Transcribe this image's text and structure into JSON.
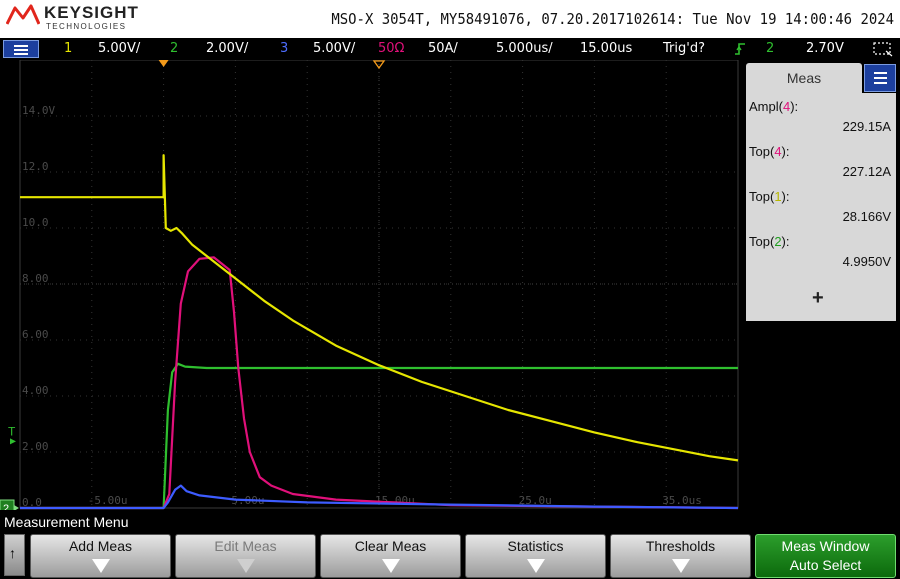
{
  "header": {
    "brand": "KEYSIGHT",
    "brand_sub": "TECHNOLOGIES",
    "scope_info": "MSO-X 3054T, MY58491076, 07.20.2017102614: Tue Nov 19 14:00:46 2024"
  },
  "status_bar": {
    "ch1_num": "1",
    "ch1_scale": "5.00V/",
    "ch2_num": "2",
    "ch2_scale": "2.00V/",
    "ch3_num": "3",
    "ch3_scale": "5.00V/",
    "ch4_label": "50Ω",
    "ch4_scale": "50A/",
    "timebase": "5.000us/",
    "delay": "15.00us",
    "trigger_status": "Trig'd?",
    "trigger_edge_icon": "rising-edge-icon",
    "trigger_source": "2",
    "trigger_level": "2.70V",
    "colors": {
      "ch1": "#e6e600",
      "ch2": "#2fbf2f",
      "ch3": "#3d5cff",
      "ch4": "#e0107a"
    }
  },
  "screen": {
    "y_labels": [
      "14.0V",
      "12.0",
      "10.0",
      "8.00",
      "6.00",
      "4.00",
      "2.00",
      "0.0"
    ],
    "x_labels": [
      "-5.00u",
      "5.00u",
      "15.00u",
      "25.0u",
      "35.0us"
    ],
    "trigger_marker": "T",
    "ground_marker": "2"
  },
  "meas": {
    "title": "Meas",
    "items": [
      {
        "name": "Ampl",
        "ch": "4",
        "value": "229.15A",
        "ch_color": "#e0107a"
      },
      {
        "name": "Top",
        "ch": "4",
        "value": "227.12A",
        "ch_color": "#e0107a"
      },
      {
        "name": "Top",
        "ch": "1",
        "value": "28.166V",
        "ch_color": "#b8b800"
      },
      {
        "name": "Top",
        "ch": "2",
        "value": "4.9950V",
        "ch_color": "#1e9e1e"
      }
    ],
    "add_symbol": "+"
  },
  "softkeys": {
    "menu_title": "Measurement Menu",
    "back_symbol": "↑",
    "keys": [
      "Add Meas",
      "Edit Meas",
      "Clear Meas",
      "Statistics",
      "Thresholds"
    ],
    "active_key_line1": "Meas Window",
    "active_key_line2": "Auto Select"
  },
  "chart_data": {
    "type": "line",
    "xlabel": "",
    "ylabel": "",
    "x_units": "us",
    "xlim": [
      -10,
      40
    ],
    "ylim": [
      0,
      16
    ],
    "series": [
      {
        "channel": "1",
        "color": "#e6e600",
        "points": [
          [
            -10,
            11.1
          ],
          [
            0,
            11.1
          ],
          [
            0,
            12.6
          ],
          [
            0.15,
            10.0
          ],
          [
            0.5,
            9.9
          ],
          [
            0.9,
            10.0
          ],
          [
            1.3,
            9.8
          ],
          [
            2,
            9.4
          ],
          [
            3,
            9.0
          ],
          [
            5,
            8.2
          ],
          [
            7,
            7.4
          ],
          [
            9,
            6.7
          ],
          [
            12,
            5.8
          ],
          [
            15,
            5.1
          ],
          [
            18,
            4.5
          ],
          [
            21,
            4.0
          ],
          [
            24,
            3.5
          ],
          [
            27,
            3.1
          ],
          [
            30,
            2.7
          ],
          [
            33,
            2.35
          ],
          [
            36,
            2.05
          ],
          [
            38,
            1.85
          ],
          [
            40,
            1.7
          ]
        ]
      },
      {
        "channel": "2",
        "color": "#2fbf2f",
        "points": [
          [
            -10,
            0.0
          ],
          [
            0,
            0.0
          ],
          [
            0.3,
            3.5
          ],
          [
            0.6,
            4.85
          ],
          [
            1.0,
            5.15
          ],
          [
            1.5,
            5.05
          ],
          [
            3,
            5.0
          ],
          [
            40,
            5.0
          ]
        ]
      },
      {
        "channel": "3",
        "color": "#3d5cff",
        "points": [
          [
            -10,
            0.0
          ],
          [
            0,
            0.0
          ],
          [
            0.3,
            0.2
          ],
          [
            0.8,
            0.65
          ],
          [
            1.2,
            0.8
          ],
          [
            1.6,
            0.6
          ],
          [
            2.5,
            0.45
          ],
          [
            5,
            0.3
          ],
          [
            10,
            0.2
          ],
          [
            20,
            0.12
          ],
          [
            30,
            0.05
          ],
          [
            40,
            0.0
          ]
        ]
      },
      {
        "channel": "4",
        "color": "#e0107a",
        "points": [
          [
            -10,
            0.0
          ],
          [
            0,
            0.0
          ],
          [
            0.4,
            0.5
          ],
          [
            0.8,
            4.5
          ],
          [
            1.2,
            7.3
          ],
          [
            1.7,
            8.45
          ],
          [
            2.5,
            8.9
          ],
          [
            3.5,
            8.95
          ],
          [
            4.6,
            8.5
          ],
          [
            4.9,
            7.0
          ],
          [
            5.2,
            5.0
          ],
          [
            5.6,
            3.2
          ],
          [
            6.0,
            2.0
          ],
          [
            6.7,
            1.1
          ],
          [
            7.5,
            0.8
          ],
          [
            9,
            0.5
          ],
          [
            12,
            0.3
          ],
          [
            16,
            0.2
          ],
          [
            20,
            0.1
          ],
          [
            30,
            0.05
          ],
          [
            40,
            0.0
          ]
        ]
      }
    ]
  }
}
